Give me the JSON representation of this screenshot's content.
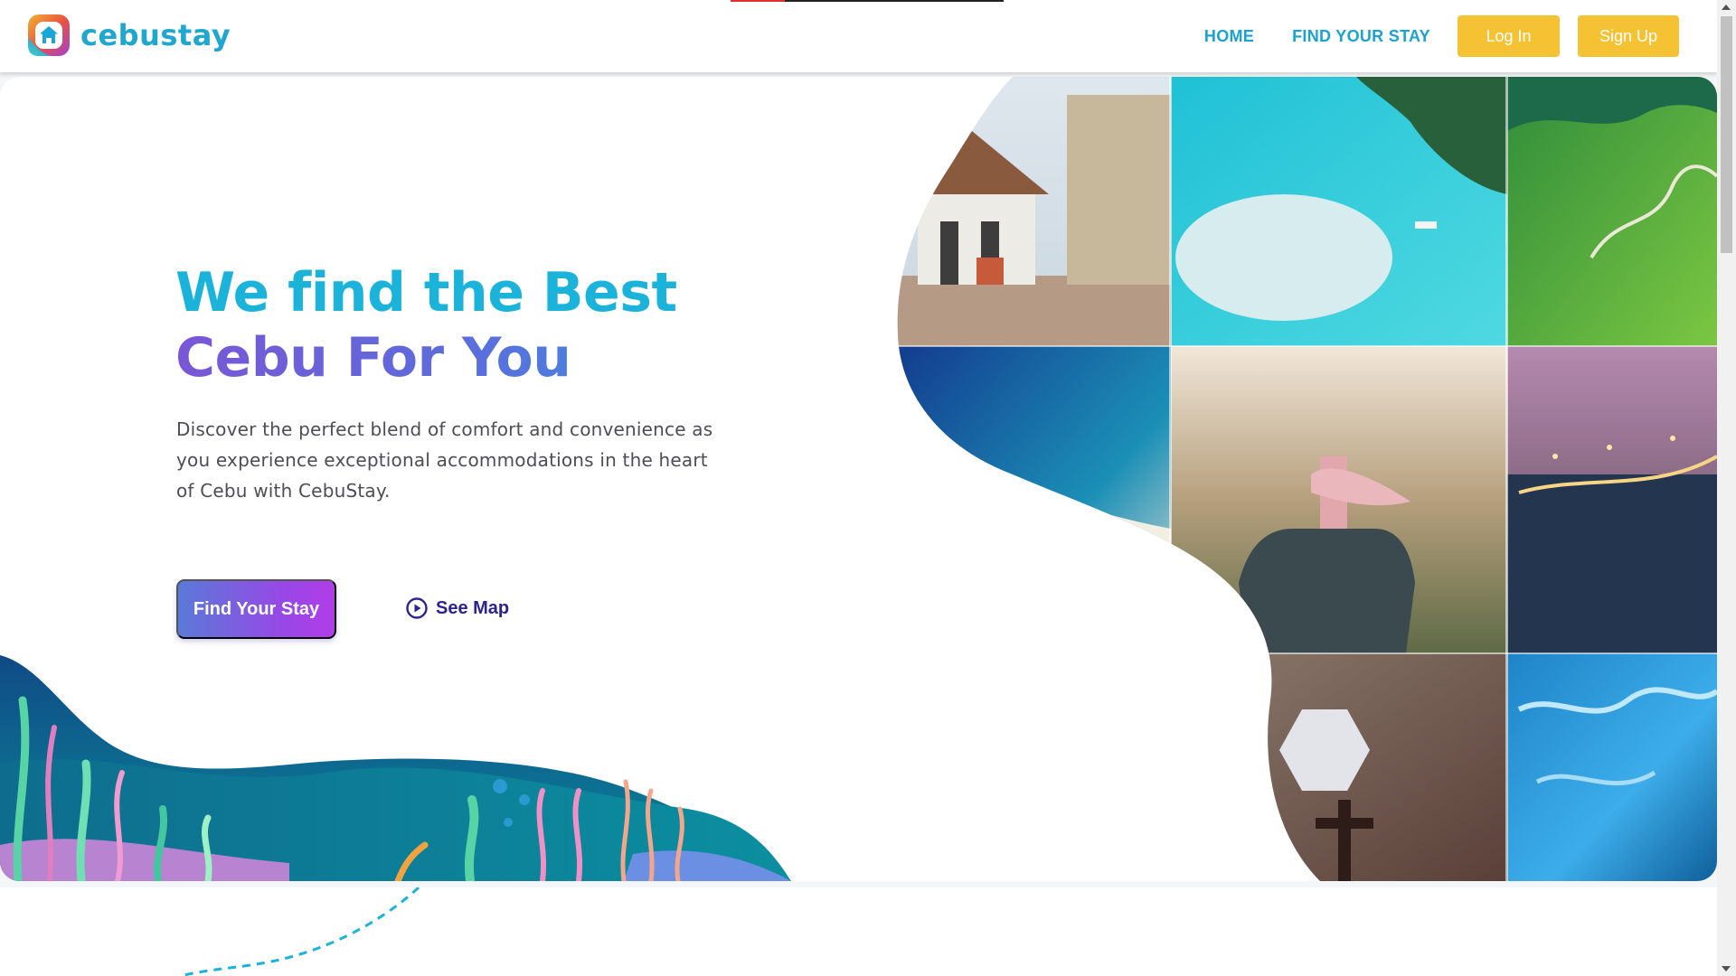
{
  "loading_bar": {
    "progress": 0.2
  },
  "brand": {
    "name": "cebustay",
    "logo_icon": "house-icon"
  },
  "nav": {
    "links": [
      "HOME",
      "FIND YOUR STAY"
    ],
    "login_label": "Log In",
    "signup_label": "Sign Up"
  },
  "hero": {
    "title_line1": "We find the Best",
    "title_line2": "Cebu For You",
    "description": "Discover the perfect blend of comfort and convenience as you experience exceptional accommodations in the heart of Cebu with CebuStay.",
    "primary_cta": "Find Your Stay",
    "secondary_cta": "See Map",
    "secondary_icon": "play-circle-icon"
  },
  "gallery": {
    "tiles": [
      "magellans-cross-pavilion-photo",
      "island-sandbar-aerial-photo",
      "green-mountains-photo",
      "beach-aerial-photo",
      "giant-hand-viewpoint-photo",
      "city-bridge-night-photo",
      "basilica-ceiling-photo",
      "underwater-sardines-photo"
    ]
  },
  "colors": {
    "brand": "#1fa7cf",
    "accent_yellow": "#f5c234",
    "title_cyan": "#1bb3d9",
    "title_purple": "#7a56d6",
    "link_navy": "#2b2390"
  }
}
